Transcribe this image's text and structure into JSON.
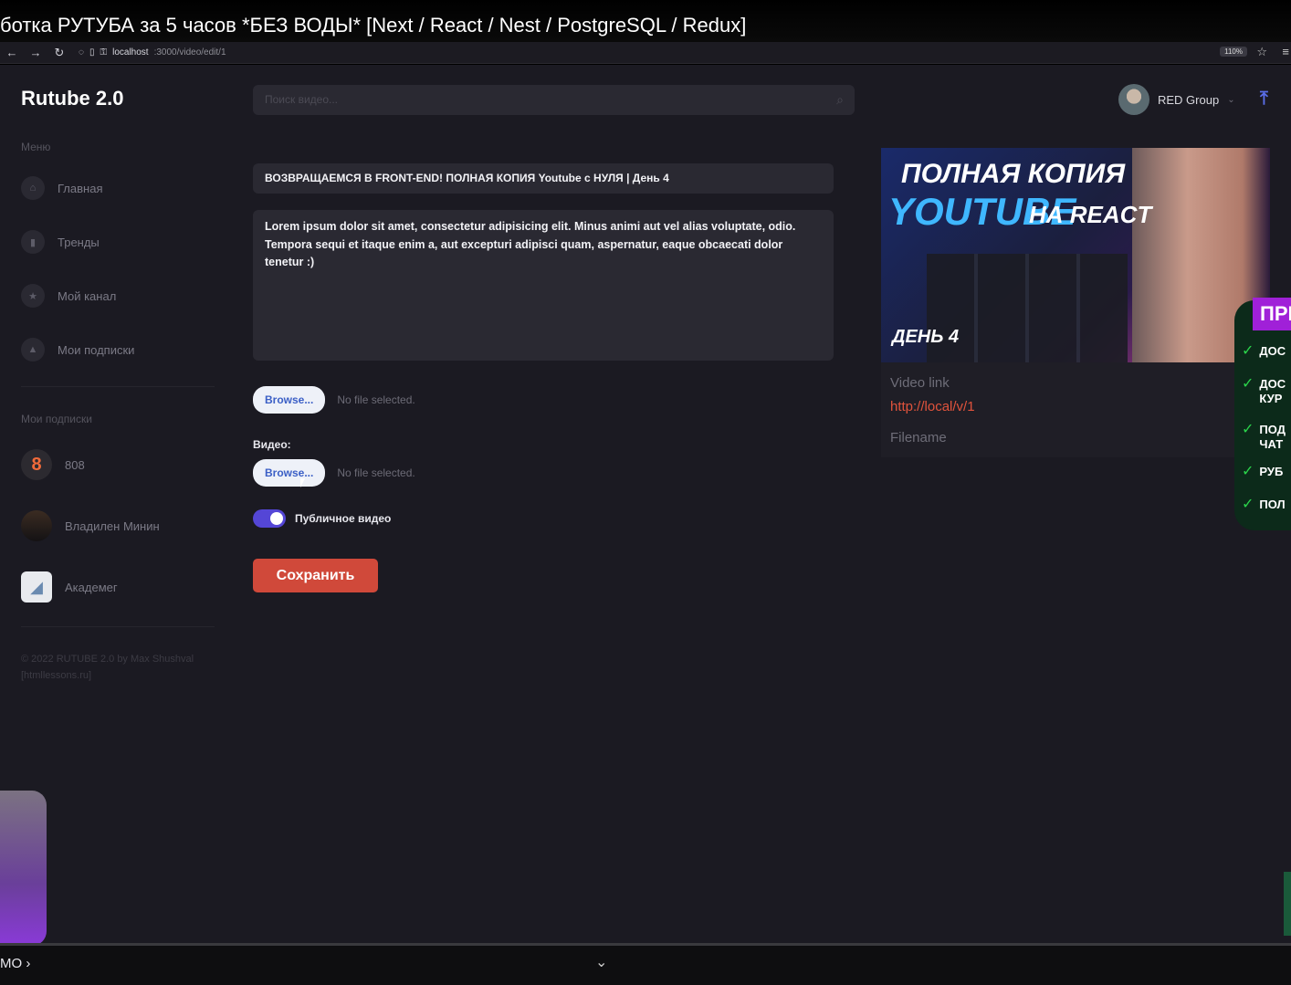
{
  "video_title": "ботка РУТУБА за 5 часов *БЕЗ ВОДЫ* [Next / React / Nest / PostgreSQL / Redux]",
  "browser": {
    "url_host": "localhost",
    "url_path": ":3000/video/edit/1",
    "zoom": "110%"
  },
  "app": {
    "logo": "Rutube 2.0",
    "search_placeholder": "Поиск видео...",
    "profile_name": "RED Group"
  },
  "sidebar": {
    "menu_title": "Меню",
    "menu": [
      {
        "label": "Главная",
        "icon": "home-icon"
      },
      {
        "label": "Тренды",
        "icon": "chart-icon"
      },
      {
        "label": "Мой канал",
        "icon": "star-icon"
      },
      {
        "label": "Мои подписки",
        "icon": "subscriptions-icon"
      }
    ],
    "subs_title": "Мои подписки",
    "subs": [
      {
        "label": "808"
      },
      {
        "label": "Владилен Минин"
      },
      {
        "label": "Академег"
      }
    ],
    "copyright_1": "© 2022 RUTUBE 2.0 by Max Shushval",
    "copyright_2": "[htmllessons.ru]"
  },
  "form": {
    "title": "ВОЗВРАЩАЕМСЯ В FRONT-END! ПОЛНАЯ КОПИЯ Youtube с НУЛЯ | День 4",
    "description": "Lorem ipsum dolor sit amet, consectetur adipisicing elit. Minus animi aut vel alias voluptate, odio. Tempora sequi et itaque enim a, aut excepturi adipisci quam, aspernatur, eaque obcaecati dolor tenetur :)",
    "browse_label": "Browse...",
    "no_file": "No file selected.",
    "video_label": "Видео:",
    "public_label": "Публичное видео",
    "public_on": true,
    "save_label": "Сохранить"
  },
  "preview": {
    "thumb_line1": "ПОЛНАЯ КОПИЯ",
    "thumb_line2": "YOUTUBE",
    "thumb_line3": "НА REACT",
    "thumb_day": "ДЕНЬ 4",
    "video_link_label": "Video link",
    "video_link": "http://local/v/1",
    "filename_label": "Filename"
  },
  "promo": {
    "head": "ПРЕ",
    "items": [
      "ДОС",
      "ДОС КУР",
      "ПОД ЧАТ",
      "РУБ",
      "ПОЛ"
    ]
  },
  "player": {
    "bottom_left": "MO ›"
  },
  "colors": {
    "accent": "#5446d6",
    "save": "#d0493a",
    "link": "#e0533c"
  }
}
